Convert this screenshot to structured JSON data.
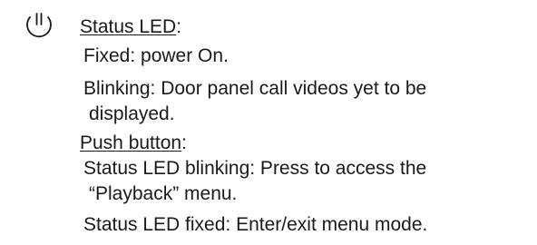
{
  "status_led": {
    "heading": "Status LED",
    "colon": ":",
    "fixed_text": "Fixed: power On.",
    "blinking_line1": "Blinking: Door panel call videos yet to be",
    "blinking_line2": "displayed."
  },
  "push_button": {
    "heading": "Push button",
    "colon": ":",
    "blinking_line1": "Status LED blinking: Press to access the",
    "blinking_line2": "“Playback” menu.",
    "fixed_text": "Status LED fixed: Enter/exit menu mode."
  },
  "icons": {
    "status_icon": "power-button-icon"
  }
}
